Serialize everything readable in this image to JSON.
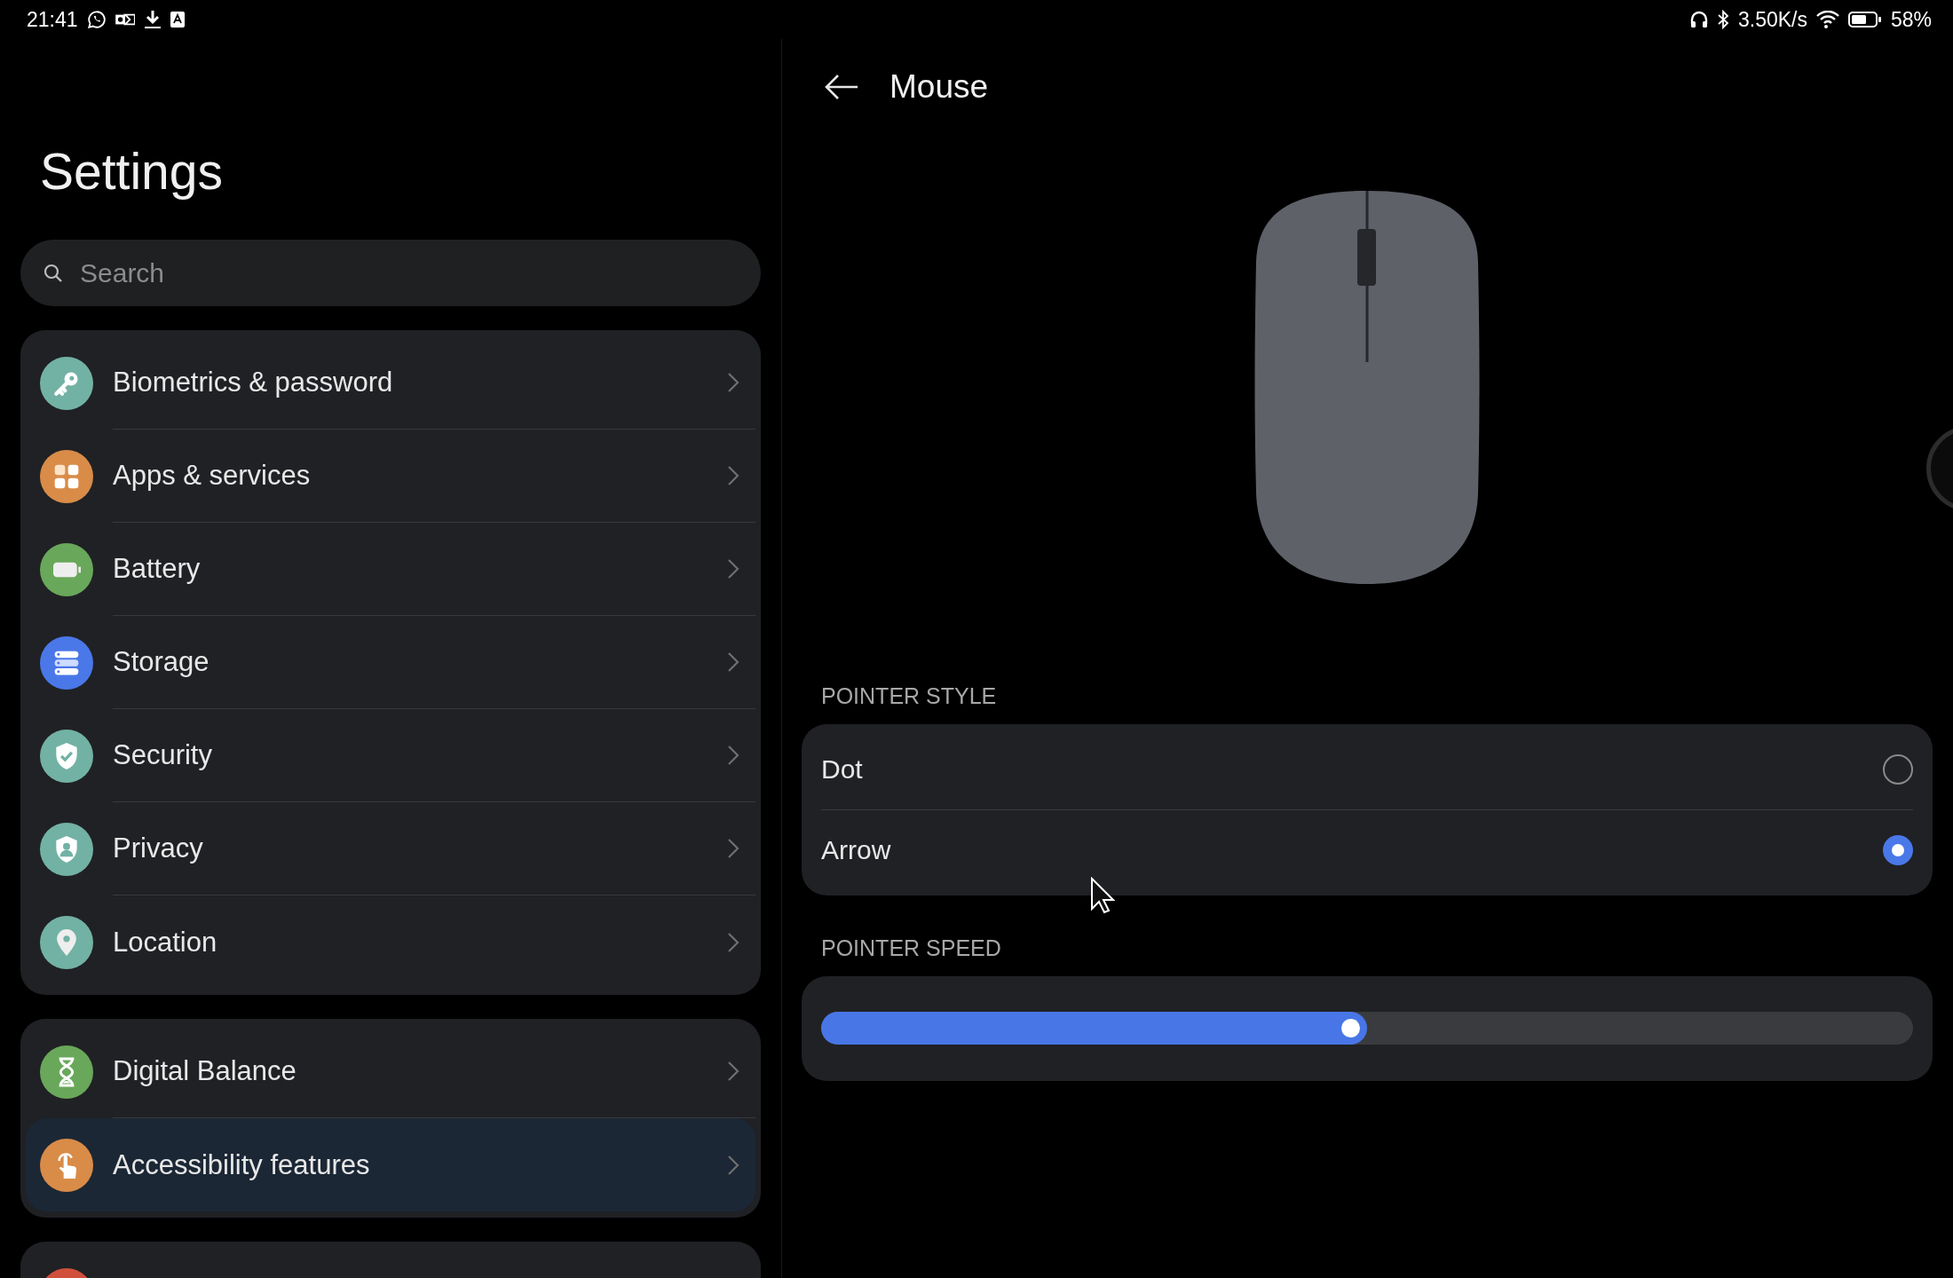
{
  "status_bar": {
    "time": "21:41",
    "network_speed": "3.50K/s",
    "battery": "58%"
  },
  "settings": {
    "title": "Settings",
    "search": {
      "placeholder": "Search"
    },
    "groups": [
      {
        "items": [
          {
            "kind": "key",
            "label": "Biometrics & password",
            "color": "#72b2a5",
            "selected": false
          },
          {
            "kind": "apps",
            "label": "Apps & services",
            "color": "#d98b48",
            "selected": false
          },
          {
            "kind": "battery",
            "label": "Battery",
            "color": "#69a85a",
            "selected": false
          },
          {
            "kind": "storage",
            "label": "Storage",
            "color": "#4a78e8",
            "selected": false
          },
          {
            "kind": "security",
            "label": "Security",
            "color": "#72b2a5",
            "selected": false
          },
          {
            "kind": "privacy",
            "label": "Privacy",
            "color": "#72b2a5",
            "selected": false
          },
          {
            "kind": "location",
            "label": "Location",
            "color": "#72b2a5",
            "selected": false
          }
        ]
      },
      {
        "items": [
          {
            "kind": "hourglass",
            "label": "Digital Balance",
            "color": "#69a85a",
            "selected": false
          },
          {
            "kind": "touch",
            "label": "Accessibility features",
            "color": "#d98b48",
            "selected": true
          }
        ]
      },
      {
        "items": [
          {
            "kind": "blank",
            "color": "#d0503c",
            "selected": false
          }
        ]
      }
    ]
  },
  "detail": {
    "title": "Mouse",
    "sections": [
      {
        "kind": "radio",
        "heading": "POINTER STYLE",
        "options": [
          {
            "label": "Dot",
            "selected": false
          },
          {
            "label": "Arrow",
            "selected": true
          }
        ]
      },
      {
        "kind": "slider",
        "heading": "POINTER SPEED",
        "level": 0.5
      }
    ]
  }
}
